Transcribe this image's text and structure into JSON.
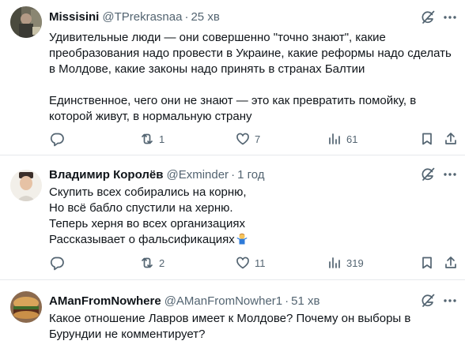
{
  "tweets": [
    {
      "name": "Missisini",
      "handle": "@TPrekrasnaa",
      "separator": "·",
      "time": "25 хв",
      "body": [
        "Удивительные люди — они совершенно \"точно знают\", какие",
        "преобразования надо провести в Украине, какие реформы надо сделать",
        "в Молдове, какие законы надо принять в странах Балтии",
        "",
        "Единственное, чего они не знают — это как превратить помойку, в",
        "которой живут, в нормальную страну"
      ],
      "replies": "",
      "retweets": "1",
      "likes": "7",
      "views": "61"
    },
    {
      "name": "Владимир Королёв",
      "handle": "@Exminder",
      "separator": "·",
      "time": "1 год",
      "body": [
        "Скупить всех собирались на корню,",
        "Но всё бабло спустили на херню.",
        "Теперь херня во всех организациях",
        "Рассказывает о фальсификациях"
      ],
      "body_emoji": "person-shrugging-emoji",
      "replies": "",
      "retweets": "2",
      "likes": "11",
      "views": "319"
    },
    {
      "name": "AManFromNowhere",
      "handle": "@AManFromNowher1",
      "separator": "·",
      "time": "51 хв",
      "body": [
        "Какое отношение Лавров имеет к Молдове? Почему он выборы в",
        "Бурундии не комментирует?"
      ]
    }
  ],
  "colors": {
    "text": "#0f1419",
    "secondary": "#536471",
    "divider": "#e6e9ec"
  }
}
